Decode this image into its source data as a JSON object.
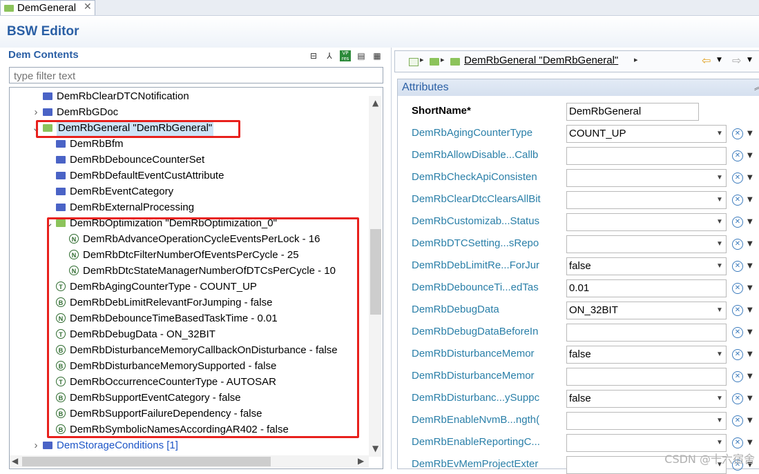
{
  "tab": {
    "title": "DemGeneral",
    "close": "✕"
  },
  "editor": {
    "title": "BSW Editor"
  },
  "left": {
    "title": "Dem Contents",
    "filter_placeholder": "type filter text",
    "toolbar_icons": [
      "collapse-all-icon",
      "link-icon",
      "vp-res-icon",
      "document-icon",
      "layout-icon"
    ],
    "tree": [
      {
        "text": "DemRbClearDTCNotification",
        "indent": 0,
        "icon": "folder-blue",
        "twisty": ""
      },
      {
        "text": "DemRbGDoc",
        "indent": 0,
        "icon": "folder-blue",
        "twisty": ">"
      },
      {
        "text": "DemRbGeneral \"DemRbGeneral\"",
        "indent": 0,
        "icon": "folder-green",
        "twisty": "v",
        "selected": true
      },
      {
        "text": "DemRbBfm",
        "indent": 1,
        "icon": "folder-blue",
        "twisty": ""
      },
      {
        "text": "DemRbDebounceCounterSet",
        "indent": 1,
        "icon": "folder-blue",
        "twisty": ""
      },
      {
        "text": "DemRbDefaultEventCustAttribute",
        "indent": 1,
        "icon": "folder-blue",
        "twisty": ""
      },
      {
        "text": "DemRbEventCategory",
        "indent": 1,
        "icon": "folder-blue",
        "twisty": ""
      },
      {
        "text": "DemRbExternalProcessing",
        "indent": 1,
        "icon": "folder-blue",
        "twisty": ""
      },
      {
        "text": "DemRbOptimization \"DemRbOptimization_0\"",
        "indent": 1,
        "icon": "folder-green",
        "twisty": "v"
      },
      {
        "text": "DemRbAdvanceOperationCycleEventsPerLock - 16",
        "indent": 2,
        "icon": "param-N",
        "twisty": ""
      },
      {
        "text": "DemRbDtcFilterNumberOfEventsPerCycle - 25",
        "indent": 2,
        "icon": "param-N",
        "twisty": ""
      },
      {
        "text": "DemRbDtcStateManagerNumberOfDTCsPerCycle - 10",
        "indent": 2,
        "icon": "param-N",
        "twisty": ""
      },
      {
        "text": "DemRbAgingCounterType - COUNT_UP",
        "indent": 1,
        "icon": "param-T",
        "twisty": ""
      },
      {
        "text": "DemRbDebLimitRelevantForJumping - false",
        "indent": 1,
        "icon": "param-B",
        "twisty": ""
      },
      {
        "text": "DemRbDebounceTimeBasedTaskTime - 0.01",
        "indent": 1,
        "icon": "param-N",
        "twisty": ""
      },
      {
        "text": "DemRbDebugData - ON_32BIT",
        "indent": 1,
        "icon": "param-T",
        "twisty": ""
      },
      {
        "text": "DemRbDisturbanceMemoryCallbackOnDisturbance - false",
        "indent": 1,
        "icon": "param-B",
        "twisty": ""
      },
      {
        "text": "DemRbDisturbanceMemorySupported - false",
        "indent": 1,
        "icon": "param-B",
        "twisty": ""
      },
      {
        "text": "DemRbOccurrenceCounterType - AUTOSAR",
        "indent": 1,
        "icon": "param-T",
        "twisty": ""
      },
      {
        "text": "DemRbSupportEventCategory - false",
        "indent": 1,
        "icon": "param-B",
        "twisty": ""
      },
      {
        "text": "DemRbSupportFailureDependency - false",
        "indent": 1,
        "icon": "param-B",
        "twisty": ""
      },
      {
        "text": "DemRbSymbolicNamesAccordingAR402 - false",
        "indent": 1,
        "icon": "param-B",
        "twisty": ""
      },
      {
        "text": "DemStorageConditions [1]",
        "indent": 0,
        "icon": "folder-blue",
        "twisty": ">",
        "link": true
      }
    ]
  },
  "right": {
    "breadcrumb": {
      "label": "DemRbGeneral \"DemRbGeneral\""
    },
    "section_title": "Attributes",
    "shortname": {
      "label": "ShortName*",
      "value": "DemRbGeneral"
    },
    "rows": [
      {
        "label": "DemRbAgingCounterType",
        "value": "COUNT_UP",
        "type": "combo"
      },
      {
        "label": "DemRbAllowDisable...Callb",
        "value": "",
        "type": "text"
      },
      {
        "label": "DemRbCheckApiConsisten",
        "value": "",
        "type": "combo"
      },
      {
        "label": "DemRbClearDtcClearsAllBit",
        "value": "",
        "type": "combo"
      },
      {
        "label": "DemRbCustomizab...Status",
        "value": "",
        "type": "combo"
      },
      {
        "label": "DemRbDTCSetting...sRepo",
        "value": "",
        "type": "combo"
      },
      {
        "label": "DemRbDebLimitRe...ForJur",
        "value": "false",
        "type": "combo"
      },
      {
        "label": "DemRbDebounceTi...edTas",
        "value": "0.01",
        "type": "text"
      },
      {
        "label": "DemRbDebugData",
        "value": "ON_32BIT",
        "type": "combo"
      },
      {
        "label": "DemRbDebugDataBeforeIn",
        "value": "",
        "type": "text"
      },
      {
        "label": "DemRbDisturbanceMemor",
        "value": "false",
        "type": "combo"
      },
      {
        "label": "DemRbDisturbanceMemor",
        "value": "",
        "type": "text"
      },
      {
        "label": "DemRbDisturbanc...ySuppc",
        "value": "false",
        "type": "combo"
      },
      {
        "label": "DemRbEnableNvmB...ngth(",
        "value": "",
        "type": "combo"
      },
      {
        "label": "DemRbEnableReportingC...",
        "value": "",
        "type": "combo"
      },
      {
        "label": "DemRbEvMemProjectExter",
        "value": "",
        "type": "combo"
      }
    ]
  },
  "watermark": "CSDN @十六宿舍",
  "colors": {
    "accent": "#2a5fa5",
    "highlight": "#e8201c",
    "label": "#2a7fa8"
  }
}
